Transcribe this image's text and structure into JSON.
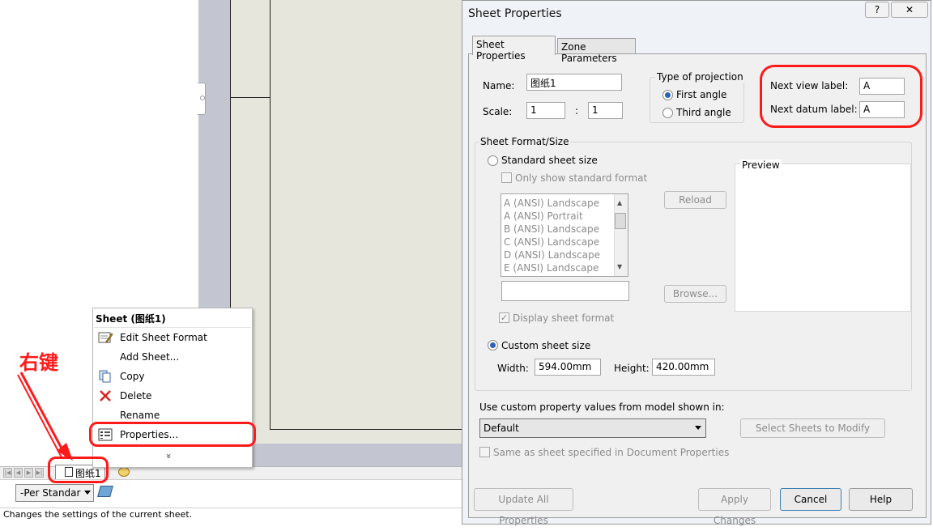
{
  "app": {
    "sheet_tab_label": "图纸1",
    "scale_select": "-Per Standar",
    "status_text": "Changes the settings of the current sheet."
  },
  "context_menu": {
    "title": "Sheet (图纸1)",
    "items": [
      {
        "label": "Edit Sheet Format",
        "icon": "edit-sheet-format-icon"
      },
      {
        "label": "Add Sheet...",
        "icon": ""
      },
      {
        "label": "Copy",
        "icon": "copy-icon"
      },
      {
        "label": "Delete",
        "icon": "delete-icon"
      },
      {
        "label": "Rename",
        "icon": ""
      },
      {
        "label": "Properties...",
        "icon": "properties-icon"
      }
    ],
    "more": "»"
  },
  "annotation": {
    "text": "右键",
    "color": "#ff1a1a"
  },
  "dialog": {
    "title": "Sheet Properties",
    "help_glyph": "?",
    "close_glyph": "✕",
    "tabs": [
      "Sheet Properties",
      "Zone Parameters"
    ],
    "name_label": "Name:",
    "name_value": "图纸1",
    "scale_label": "Scale:",
    "scale_num": "1",
    "scale_sep": ":",
    "scale_den": "1",
    "projection": {
      "label": "Type of projection",
      "first": "First angle",
      "third": "Third angle",
      "selected": "First angle"
    },
    "next_view_label": "Next view label:",
    "next_view_value": "A",
    "next_datum_label": "Next datum label:",
    "next_datum_value": "A",
    "format_group": {
      "label": "Sheet Format/Size",
      "standard": "Standard sheet size",
      "only_standard": "Only show standard format",
      "sizes": [
        "A (ANSI) Landscape",
        "A (ANSI) Portrait",
        "B (ANSI) Landscape",
        "C (ANSI) Landscape",
        "D (ANSI) Landscape",
        "E (ANSI) Landscape"
      ],
      "reload": "Reload",
      "browse": "Browse...",
      "display_format": "Display sheet format",
      "custom": "Custom sheet size",
      "width_label": "Width:",
      "width_value": "594.00mm",
      "height_label": "Height:",
      "height_value": "420.00mm",
      "preview_label": "Preview"
    },
    "custom_prop_label": "Use custom property values from model shown in:",
    "custom_prop_value": "Default",
    "select_sheets": "Select Sheets to Modify",
    "same_as_doc": "Same as sheet specified in Document Properties",
    "buttons": {
      "update_all": "Update All Properties",
      "apply": "Apply Changes",
      "cancel": "Cancel",
      "help": "Help"
    }
  }
}
